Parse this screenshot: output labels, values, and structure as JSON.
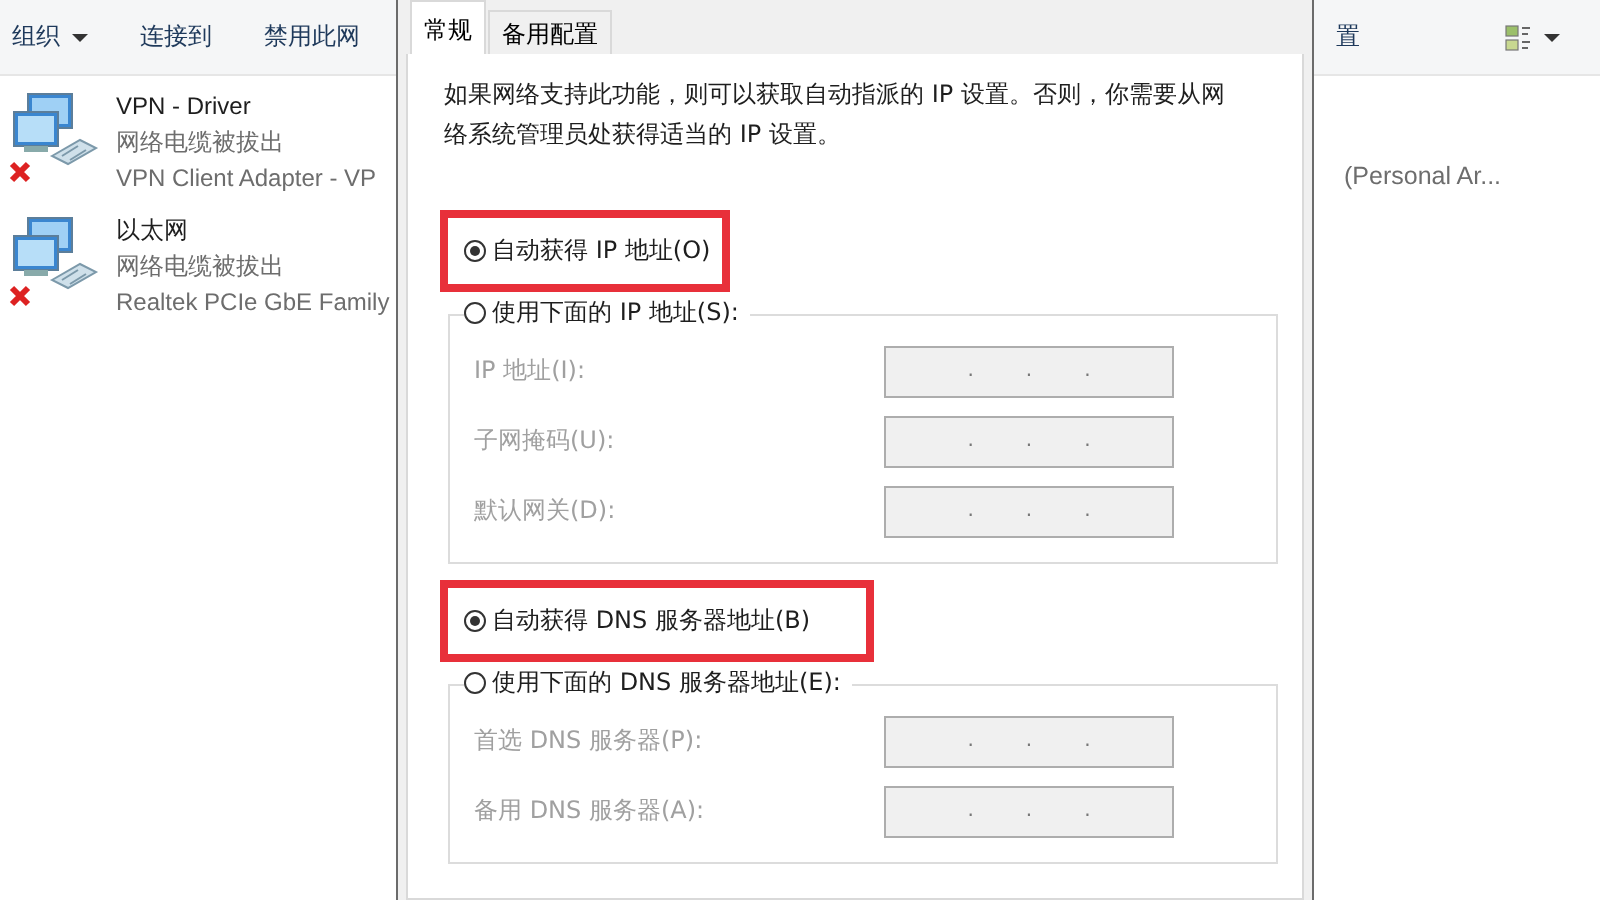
{
  "explorer": {
    "toolbar": [
      {
        "label": "组织",
        "dropdown": true
      },
      {
        "label": "连接到",
        "dropdown": false
      },
      {
        "label": "禁用此网",
        "dropdown": false
      }
    ],
    "toolbar_right": {
      "label": "置"
    },
    "connections": [
      {
        "name": "VPN - Driver",
        "status": "网络电缆被拔出",
        "adapter": "VPN Client Adapter - VP",
        "disconnected": true,
        "detail": "(Personal Ar..."
      },
      {
        "name": "以太网",
        "status": "网络电缆被拔出",
        "adapter": "Realtek PCIe GbE Family",
        "disconnected": true
      }
    ]
  },
  "dialog": {
    "tabs": [
      {
        "label": "常规",
        "selected": true
      },
      {
        "label": "备用配置",
        "selected": false
      }
    ],
    "description": "如果网络支持此功能，则可以获取自动指派的 IP 设置。否则，你需要从网络系统管理员处获得适当的 IP 设置。",
    "sections": [
      {
        "highlighted": true,
        "options": [
          {
            "label": "自动获得 IP 地址(O)",
            "selected": true
          },
          {
            "label": "使用下面的 IP 地址(S):",
            "selected": false
          }
        ],
        "fields": [
          {
            "label": "IP 地址(I):",
            "separators": [
              ".",
              ".",
              "."
            ],
            "disabled": true
          },
          {
            "label": "子网掩码(U):",
            "separators": [
              ".",
              ".",
              "."
            ],
            "disabled": true
          },
          {
            "label": "默认网关(D):",
            "separators": [
              ".",
              ".",
              "."
            ],
            "disabled": true
          }
        ]
      },
      {
        "highlighted": true,
        "options": [
          {
            "label": "自动获得 DNS 服务器地址(B)",
            "selected": true
          },
          {
            "label": "使用下面的 DNS 服务器地址(E):",
            "selected": false
          }
        ],
        "fields": [
          {
            "label": "首选 DNS 服务器(P):",
            "separators": [
              ".",
              ".",
              "."
            ],
            "disabled": true
          },
          {
            "label": "备用 DNS 服务器(A):",
            "separators": [
              ".",
              ".",
              "."
            ],
            "disabled": true
          }
        ]
      }
    ]
  }
}
